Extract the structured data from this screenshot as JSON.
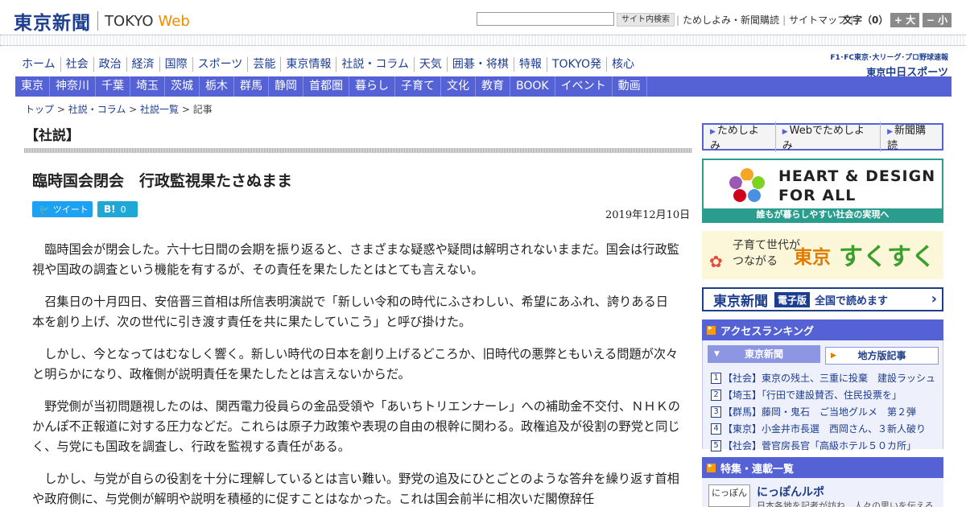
{
  "header": {
    "logo_jp": "東京新聞",
    "logo_en": "TOKYO",
    "logo_web": "Web",
    "search_button": "サイト内検索",
    "links": [
      "ためしよみ・新聞購読",
      "サイトマップ"
    ],
    "font_size_label": "文字（0）",
    "font_larger": "+ 大",
    "font_smaller": "− 小"
  },
  "main_nav": [
    "ホーム",
    "社会",
    "政治",
    "経済",
    "国際",
    "スポーツ",
    "芸能",
    "東京情報",
    "社説・コラム",
    "天気",
    "囲碁・将棋",
    "特報",
    "TOKYO発",
    "核心"
  ],
  "sports_banner": {
    "top": "F1･FC東京･大リーグ･プロ野球速報",
    "logo_prefix": "東京",
    "logo": "中日スポーツ"
  },
  "sub_nav": [
    "東京",
    "神奈川",
    "千葉",
    "埼玉",
    "茨城",
    "栃木",
    "群馬",
    "静岡",
    "首都圏",
    "暮らし",
    "子育て",
    "文化",
    "教育",
    "BOOK",
    "イベント",
    "動画"
  ],
  "breadcrumb": [
    "トップ",
    "社説・コラム",
    "社説一覧",
    "記事"
  ],
  "article": {
    "section": "【社説】",
    "title": "臨時国会閉会　行政監視果たさぬまま",
    "tweet_label": "ツイート",
    "hatena_label": "B!",
    "hatena_count": "0",
    "date": "2019年12月10日",
    "paragraphs": [
      "臨時国会が閉会した。六十七日間の会期を振り返ると、さまざまな疑惑や疑問は解明されないままだ。国会は行政監視や国政の調査という機能を有するが、その責任を果たしたとはとても言えない。",
      "召集日の十月四日、安倍晋三首相は所信表明演説で「新しい令和の時代にふさわしい、希望にあふれ、誇りある日本を創り上げ、次の世代に引き渡す責任を共に果たしていこう」と呼び掛けた。",
      "しかし、今となってはむなしく響く。新しい時代の日本を創り上げるどころか、旧時代の悪弊ともいえる問題が次々と明らかになり、政権側が説明責任を果たしたとは言えないからだ。",
      "野党側が当初問題視したのは、関西電力役員らの金品受領や「あいちトリエンナーレ」への補助金不交付、ＮＨＫのかんぽ不正報道に対する圧力などだ。これらは原子力政策や表現の自由の根幹に関わる。政権追及が役割の野党と同じく、与党にも国政を調査し、行政を監視する責任がある。",
      "しかし、与党が自らの役割を十分に理解しているとは言い難い。野党の追及にひとごとのような答弁を繰り返す首相や政府側に、与党側が解明や説明を積極的に促すことはなかった。これは国会前半に相次いだ閣僚辞任"
    ]
  },
  "sidebar": {
    "buttons": [
      "ためしよみ",
      "Webでためしよみ",
      "新聞購読"
    ],
    "heart_design": {
      "line1": "HEART & DESIGN",
      "line2": "FOR ALL",
      "footer": "誰もが暮らしやすい社会の実現へ"
    },
    "sukusuku": {
      "line1": "子育て世代が",
      "line2": "つながる",
      "city": "東京",
      "name": "すくすく"
    },
    "denshi": {
      "logo": "東京新聞",
      "tag": "電子版",
      "text": "全国で読めます"
    },
    "ranking": {
      "heading": "アクセスランキング",
      "tab_active": "東京新聞",
      "tab_other": "地方版記事",
      "items": [
        {
          "num": "1",
          "text": "【社会】東京の残土、三重に投棄　建設ラッシュ"
        },
        {
          "num": "2",
          "text": "【埼玉】「行田で建設賛否、住民投票を」"
        },
        {
          "num": "3",
          "text": "【群馬】藤岡・鬼石　ご当地グルメ　第２弾"
        },
        {
          "num": "4",
          "text": "【東京】小金井市長選　西岡さん、３新人破り"
        },
        {
          "num": "5",
          "text": "【社会】菅官房長官「高級ホテル５０カ所」"
        }
      ]
    },
    "feature": {
      "heading": "特集・連載一覧",
      "thumb": "にっぽん",
      "title": "にっぽんルポ",
      "sub": "日本各地を記者が訪ね、人々の思いを伝える"
    }
  }
}
